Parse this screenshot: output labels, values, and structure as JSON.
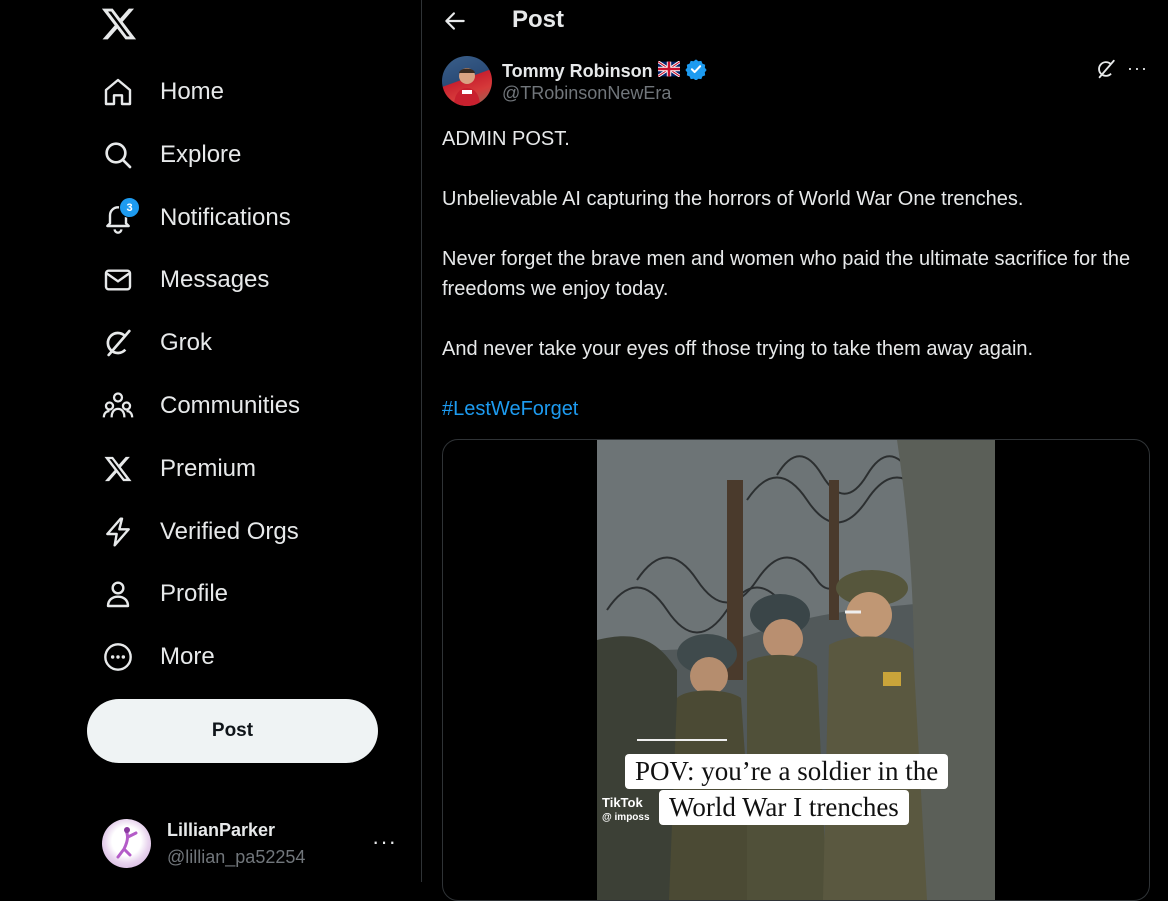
{
  "nav": {
    "items": [
      {
        "label": "Home",
        "icon": "home-icon"
      },
      {
        "label": "Explore",
        "icon": "search-icon"
      },
      {
        "label": "Notifications",
        "icon": "bell-icon",
        "badge": "3"
      },
      {
        "label": "Messages",
        "icon": "envelope-icon"
      },
      {
        "label": "Grok",
        "icon": "grok-icon"
      },
      {
        "label": "Communities",
        "icon": "people-icon"
      },
      {
        "label": "Premium",
        "icon": "x-logo-icon"
      },
      {
        "label": "Verified Orgs",
        "icon": "lightning-icon"
      },
      {
        "label": "Profile",
        "icon": "person-icon"
      },
      {
        "label": "More",
        "icon": "more-circle-icon"
      }
    ],
    "post_button": "Post"
  },
  "account": {
    "name": "LillianParker",
    "handle": "@lillian_pa52254",
    "more": "···"
  },
  "header": {
    "title": "Post"
  },
  "post": {
    "author_name": "Tommy Robinson",
    "author_flag": "🇬🇧",
    "author_handle": "@TRobinsonNewEra",
    "more": "···",
    "paragraphs": [
      "ADMIN POST.",
      "Unbelievable AI capturing the horrors of World War One trenches.",
      "Never forget the brave men and women who paid the ultimate sacrifice for the freedoms we enjoy today.",
      "And never take your eyes off those trying to take them away again."
    ],
    "hashtag": "#LestWeForget",
    "media": {
      "caption_line1": "POV: you’re a soldier in the",
      "caption_line2": "World War I trenches",
      "watermark": "TikTok",
      "watermark_user": "@ imposs"
    }
  },
  "colors": {
    "accent": "#1d9bf0",
    "background": "#000000",
    "text": "#e7e9ea",
    "muted": "#71767b"
  }
}
